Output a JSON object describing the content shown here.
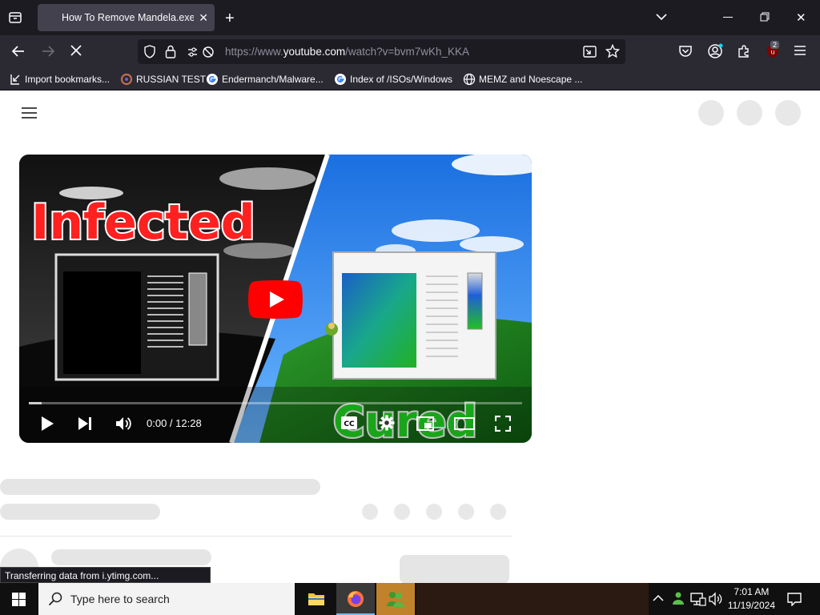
{
  "browser": {
    "tab_title": "How To Remove Mandela.exe (",
    "url_prefix": "https://www.",
    "url_domain": "youtube.com",
    "url_suffix": "/watch?v=bvm7wKh_KKA",
    "extension_badge": "2"
  },
  "bookmarks": [
    {
      "label": "Import bookmarks...",
      "icon": "import-icon"
    },
    {
      "label": "RUSSIAN TEST",
      "icon": "site-icon"
    },
    {
      "label": "Endermanch/Malware...",
      "icon": "google-icon"
    },
    {
      "label": "Index of /ISOs/Windows",
      "icon": "google-icon"
    },
    {
      "label": "MEMZ and Noescape ...",
      "icon": "globe-icon"
    }
  ],
  "video": {
    "thumb_left_text": "Infected",
    "thumb_right_text": "Cured",
    "time_display": "0:00 / 12:28",
    "progress": 0.0
  },
  "status_bar": "Transferring data from i.ytimg.com...",
  "taskbar": {
    "search_placeholder": "Type here to search",
    "time": "7:01 AM",
    "date": "11/19/2024"
  },
  "colors": {
    "youtube_red": "#ff0000",
    "browser_dark": "#1c1b22",
    "toolbar": "#2b2a33"
  }
}
